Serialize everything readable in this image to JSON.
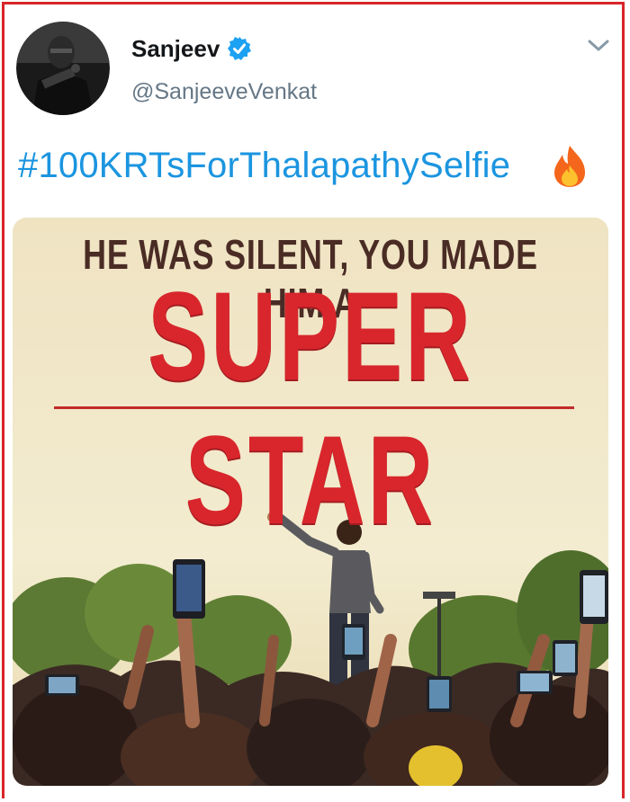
{
  "user": {
    "display_name": "Sanjeev",
    "handle": "@SanjeeveVenkat",
    "verified": true,
    "avatar_icon": "profile-photo"
  },
  "tweet": {
    "text": "#100KRTsForThalapathySelfie",
    "emoji_icon": "fire-icon",
    "hashtag_color": "#1b95e0"
  },
  "media": {
    "headline_small": "HE WAS SILENT, YOU MADE HIM A",
    "headline_big": "SUPER STAR",
    "headline_color": "#d8262c"
  },
  "colors": {
    "frame": "#d9242b",
    "verified": "#1da1f2",
    "handle": "#657786"
  }
}
